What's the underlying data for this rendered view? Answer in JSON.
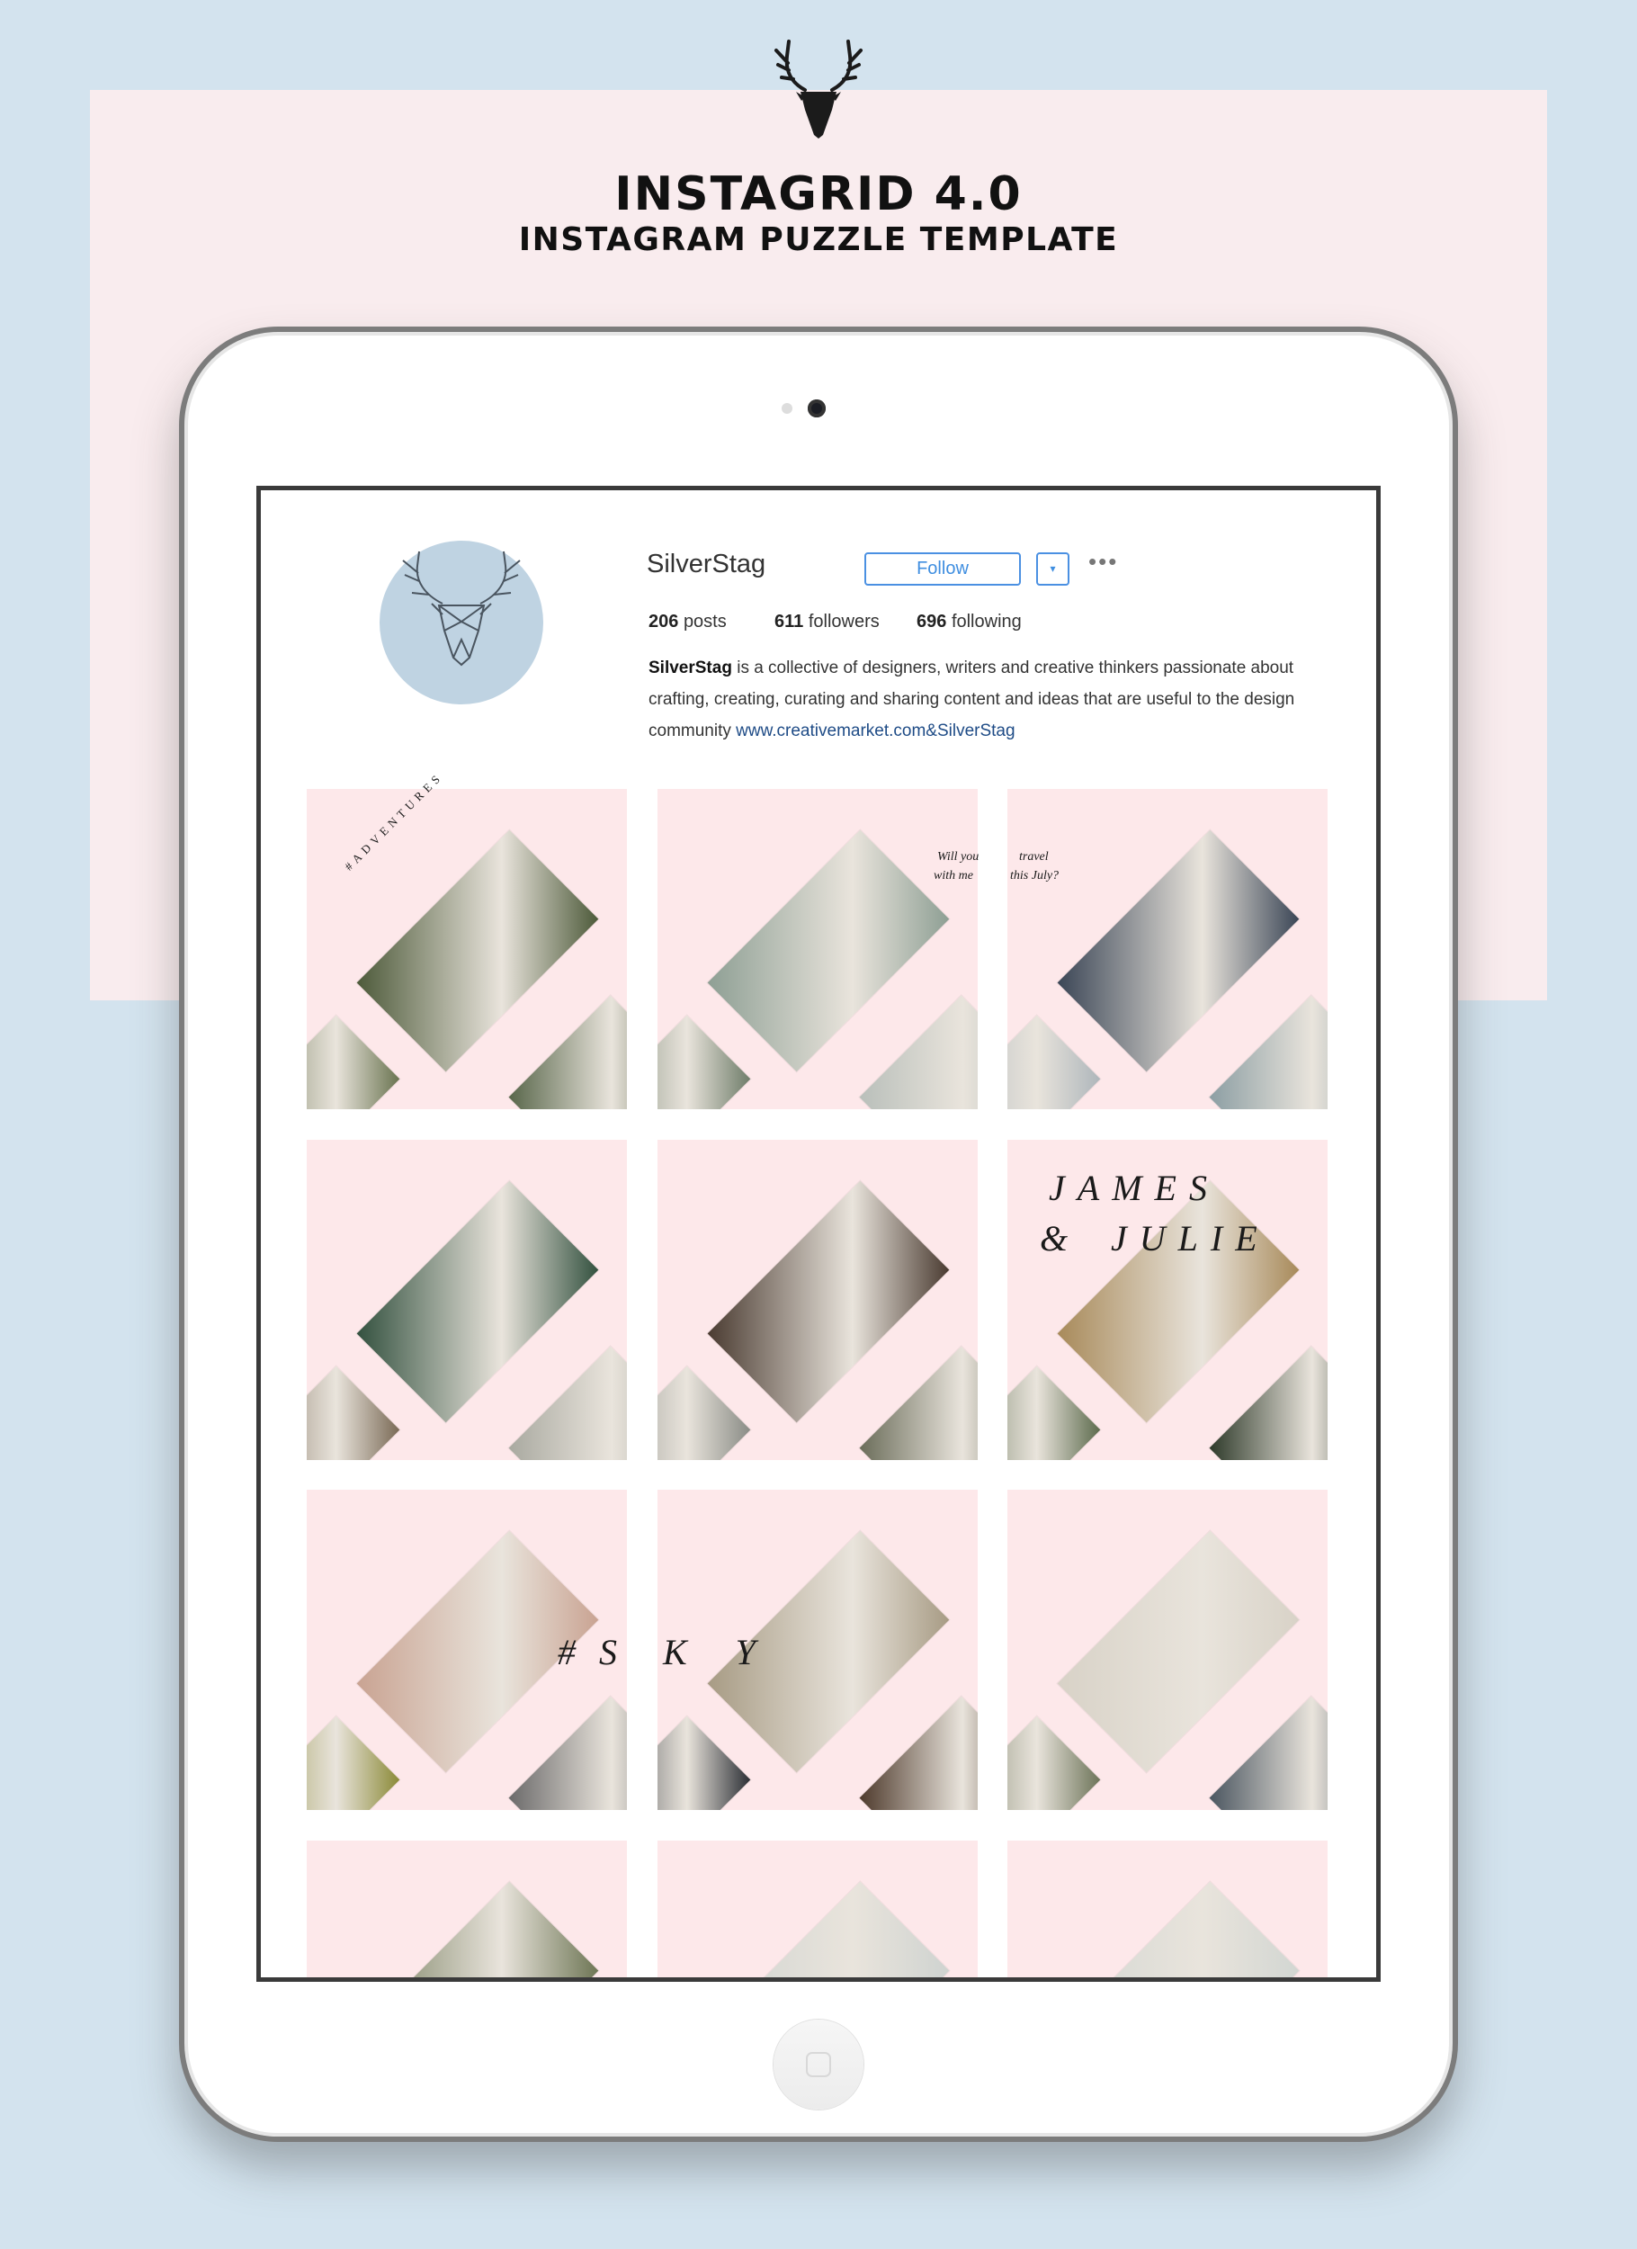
{
  "header": {
    "title": "INSTAGRID 4.0",
    "subtitle": "INSTAGRAM PUZZLE TEMPLATE",
    "logo_icon": "stag-head-icon"
  },
  "profile": {
    "username": "SilverStag",
    "follow_label": "Follow",
    "dropdown_icon": "▾",
    "more_icon": "•••",
    "stats": [
      {
        "count": "206",
        "label": "posts"
      },
      {
        "count": "611",
        "label": "followers"
      },
      {
        "count": "696",
        "label": "following"
      }
    ],
    "bio_name": "SilverStag",
    "bio_text": " is a collective of designers, writers and creative thinkers passionate about crafting, creating, curating and sharing content and ideas that are useful to the design community ",
    "bio_link": "www.creativemarket.com&SilverStag",
    "avatar_color": "#bfd3e2",
    "accent_color": "#3f8ee0"
  },
  "grid": {
    "tile_color": "#fde8ea",
    "tiles": [
      {
        "photos": [
          "#4d5a3a",
          "#6a7450",
          "#58664a"
        ]
      },
      {
        "photos": [
          "#8e9f94",
          "#6f7d6a",
          "#b9bfba"
        ]
      },
      {
        "photos": [
          "#3b4656",
          "#aeb6bb",
          "#8c9ea3"
        ]
      },
      {
        "photos": [
          "#33513f",
          "#7a6a56",
          "#a9a9a0"
        ]
      },
      {
        "photos": [
          "#4a3b31",
          "#8a8c86",
          "#6b6d5a"
        ]
      },
      {
        "photos": [
          "#a88a5a",
          "#5d6b4d",
          "#2e3a2a"
        ]
      },
      {
        "photos": [
          "#c9a392",
          "#8b8a38",
          "#6b6a6a"
        ]
      },
      {
        "photos": [
          "#a79b84",
          "#2c2f35",
          "#4e3a2c"
        ]
      },
      {
        "photos": [
          "#d8d2c7",
          "#6d7459",
          "#4b5660"
        ]
      },
      {
        "photos": [
          "#6e7655",
          "#c9b39e",
          "#5a5a4a"
        ]
      },
      {
        "photos": [
          "#cfd3d0",
          "#9ca39b",
          "#3e3a33"
        ]
      },
      {
        "photos": [
          "#d2d6d2",
          "#59644f",
          "#2f3a2f"
        ]
      }
    ],
    "texts": {
      "adventures": "#ADVENTURES",
      "travel_l1a": "Will you",
      "travel_l1b": "travel",
      "travel_l2a": "with me",
      "travel_l2b": "this July?",
      "james": "JAMES",
      "amp": "&",
      "julie": "JULIE",
      "sky_a": "# S",
      "sky_b": "K Y"
    }
  }
}
